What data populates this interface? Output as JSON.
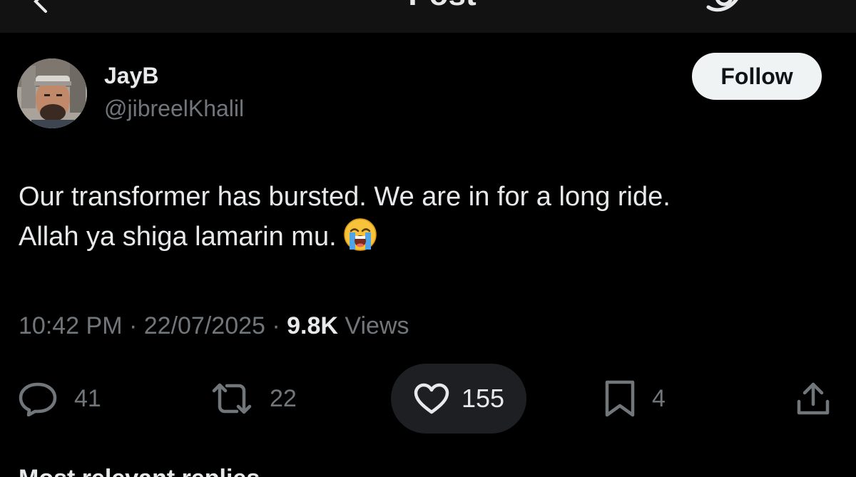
{
  "header": {
    "title": "Post",
    "back_icon": "arrow-left-icon",
    "grok_icon": "grok-icon"
  },
  "author": {
    "name": "JayB",
    "handle": "@jibreelKhalil",
    "follow_label": "Follow"
  },
  "post": {
    "line1": "Our transformer has bursted. We are in for a long ride.",
    "line2": "Allah ya shiga lamarin mu.",
    "emoji": "loudly-crying-face-emoji"
  },
  "meta": {
    "time": "10:42 PM",
    "separator": " · ",
    "date": "22/07/2025",
    "views_count": "9.8K",
    "views_label": "Views"
  },
  "actions": {
    "replies": "41",
    "reposts": "22",
    "likes": "155",
    "bookmarks": "4",
    "share_icon": "share-icon"
  },
  "bottom": {
    "partial_text": "Most relevant replies"
  },
  "colors": {
    "background": "#000000",
    "header_bg": "#121212",
    "text_primary": "#e7e9ea",
    "text_secondary": "#71767b",
    "follow_bg": "#eff3f4",
    "like_pill_bg": "#1d1f23"
  }
}
